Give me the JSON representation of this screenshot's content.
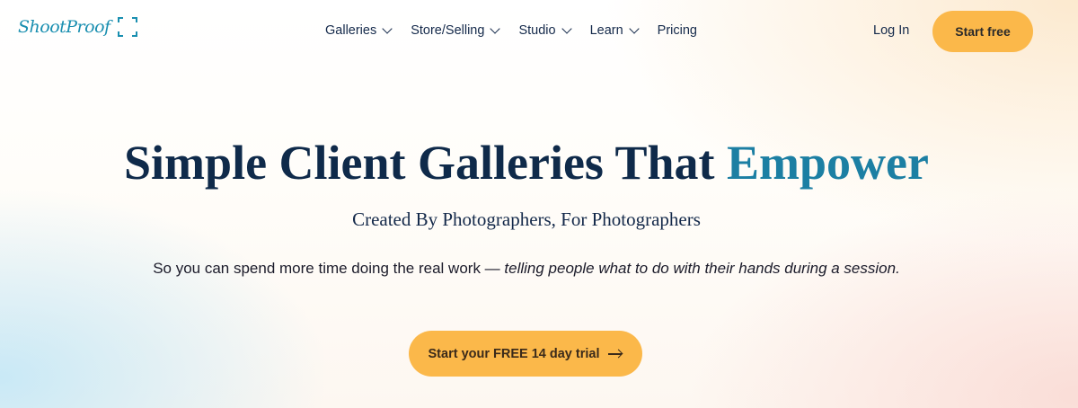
{
  "brand": {
    "name": "ShootProof",
    "color": "#1a8fb0",
    "mark_icon": "viewfinder-brackets-icon"
  },
  "nav": {
    "items": [
      {
        "label": "Galleries",
        "has_dropdown": true
      },
      {
        "label": "Store/Selling",
        "has_dropdown": true
      },
      {
        "label": "Studio",
        "has_dropdown": true
      },
      {
        "label": "Learn",
        "has_dropdown": true
      },
      {
        "label": "Pricing",
        "has_dropdown": false
      }
    ],
    "login_label": "Log In",
    "start_free_label": "Start free"
  },
  "hero": {
    "title_main": "Simple Client Galleries That",
    "title_accent": "Empower",
    "subtitle": "Created By Photographers, For Photographers",
    "tagline_plain": "So you can spend more time doing the real work —",
    "tagline_italic": "telling people what to do with their hands during a session.",
    "cta_label": "Start your FREE 14 day trial",
    "cta_icon": "arrow-right-icon"
  },
  "colors": {
    "accent_button": "#fbb84a",
    "title": "#0f2a4a",
    "title_accent": "#1c7fa3"
  }
}
